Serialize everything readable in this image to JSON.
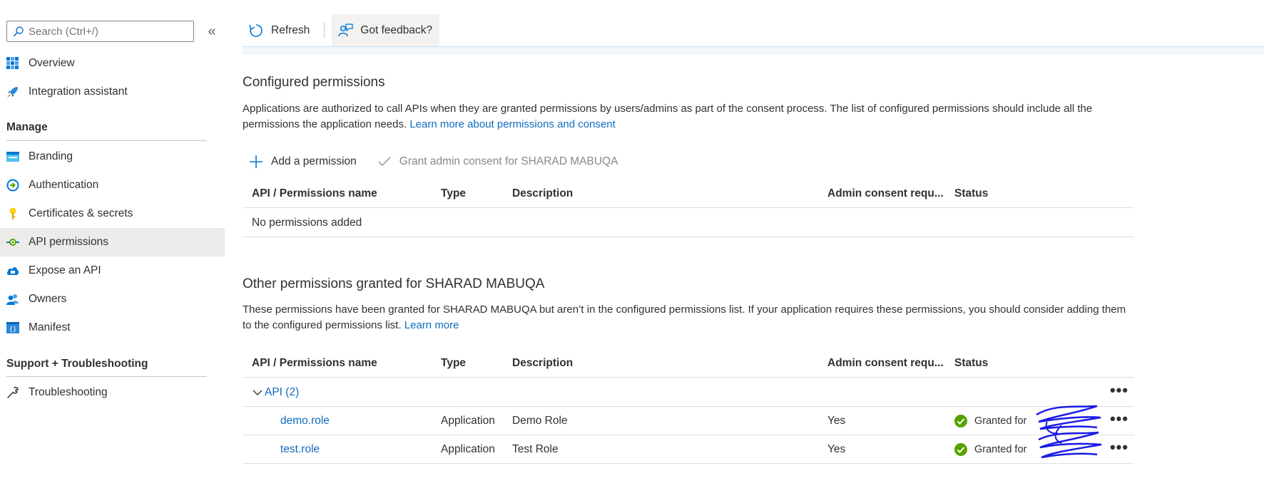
{
  "sidebar": {
    "search_placeholder": "Search (Ctrl+/)",
    "collapse_glyph": "«",
    "top_items": [
      {
        "label": "Overview",
        "icon": "overview-grid-icon"
      },
      {
        "label": "Integration assistant",
        "icon": "rocket-icon"
      }
    ],
    "manage_heading": "Manage",
    "manage_items": [
      {
        "label": "Branding",
        "icon": "branding-icon"
      },
      {
        "label": "Authentication",
        "icon": "authentication-icon"
      },
      {
        "label": "Certificates & secrets",
        "icon": "key-icon"
      },
      {
        "label": "API permissions",
        "icon": "api-permissions-icon",
        "active": true
      },
      {
        "label": "Expose an API",
        "icon": "cloud-icon"
      },
      {
        "label": "Owners",
        "icon": "owners-icon"
      },
      {
        "label": "Manifest",
        "icon": "manifest-icon"
      }
    ],
    "support_heading": "Support + Troubleshooting",
    "support_items": [
      {
        "label": "Troubleshooting",
        "icon": "wrench-icon"
      }
    ]
  },
  "toolbar": {
    "refresh_label": "Refresh",
    "feedback_label": "Got feedback?"
  },
  "configured": {
    "title": "Configured permissions",
    "description": "Applications are authorized to call APIs when they are granted permissions by users/admins as part of the consent process. The list of configured permissions should include all the permissions the application needs.",
    "link": "Learn more about permissions and consent",
    "add_label": "Add a permission",
    "grant_label": "Grant admin consent for SHARAD MABUQA",
    "columns": [
      "API / Permissions name",
      "Type",
      "Description",
      "Admin consent requ...",
      "Status"
    ],
    "empty_text": "No permissions added"
  },
  "other": {
    "title": "Other permissions granted for SHARAD MABUQA",
    "description": "These permissions have been granted for SHARAD MABUQA but aren’t in the configured permissions list. If your application requires these permissions, you should consider adding them to the configured permissions list.",
    "link": "Learn more",
    "columns": [
      "API / Permissions name",
      "Type",
      "Description",
      "Admin consent requ...",
      "Status"
    ],
    "group_label": "API (2)",
    "rows": [
      {
        "name": "demo.role",
        "type": "Application",
        "description": "Demo Role",
        "admin_consent": "Yes",
        "status": "Granted for"
      },
      {
        "name": "test.role",
        "type": "Application",
        "description": "Test Role",
        "admin_consent": "Yes",
        "status": "Granted for"
      }
    ],
    "more_glyph": "•••"
  },
  "colors": {
    "accent": "#0f6cbd",
    "success": "#57a300",
    "active_bg": "#edebe9",
    "scribble": "#1a1ae6"
  }
}
